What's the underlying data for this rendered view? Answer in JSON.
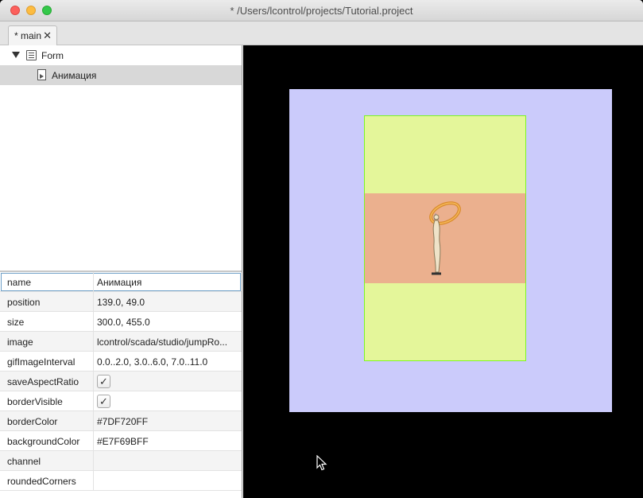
{
  "window": {
    "title": "* /Users/lcontrol/projects/Tutorial.project"
  },
  "tabs": [
    {
      "label": "* main",
      "close_glyph": "✕"
    }
  ],
  "tree": {
    "root": {
      "label": "Form",
      "icon": "form-icon",
      "expanded": true
    },
    "children": [
      {
        "label": "Анимация",
        "icon": "animation-icon",
        "selected": true
      }
    ]
  },
  "properties": [
    {
      "key": "name",
      "value": "Анимация",
      "type": "text"
    },
    {
      "key": "position",
      "value": "139.0, 49.0",
      "type": "text"
    },
    {
      "key": "size",
      "value": "300.0, 455.0",
      "type": "text"
    },
    {
      "key": "image",
      "value": "lcontrol/scada/studio/jumpRo...",
      "type": "text"
    },
    {
      "key": "gifImageInterval",
      "value": "0.0..2.0, 3.0..6.0, 7.0..11.0",
      "type": "text"
    },
    {
      "key": "saveAspectRatio",
      "value": "✓",
      "type": "checkbox"
    },
    {
      "key": "borderVisible",
      "value": "✓",
      "type": "checkbox"
    },
    {
      "key": "borderColor",
      "value": "#7DF720FF",
      "type": "text"
    },
    {
      "key": "backgroundColor",
      "value": "#E7F69BFF",
      "type": "text"
    },
    {
      "key": "channel",
      "value": "",
      "type": "text"
    },
    {
      "key": "roundedCorners",
      "value": "",
      "type": "text"
    }
  ],
  "colors": {
    "form_background": "#cbcbfb",
    "animation_border": "#7DF720",
    "animation_background": "#E7F69B",
    "band": "#ebb08e",
    "canvas": "#000000"
  }
}
